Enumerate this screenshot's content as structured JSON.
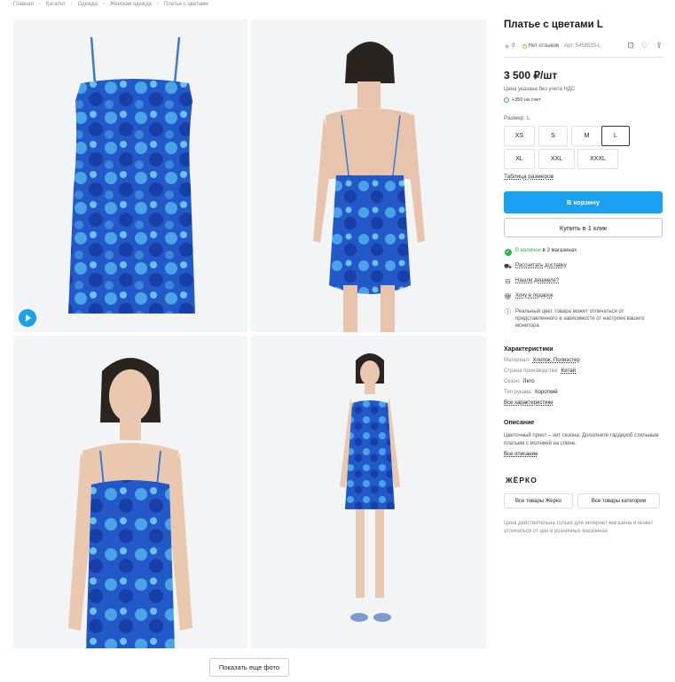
{
  "breadcrumb": [
    "Главная",
    "Каталог",
    "Одежда",
    "Женская одежда",
    "Платье с цветами"
  ],
  "gallery": {
    "photos": [
      {
        "alt": "dress-front-photo"
      },
      {
        "alt": "model-back-photo"
      },
      {
        "alt": "model-front-closeup-photo"
      },
      {
        "alt": "model-full-length-photo"
      }
    ],
    "more_label": "Показать еще фото"
  },
  "product": {
    "title": "Платье с цветами L",
    "rating": "0",
    "reviews": "Нет отзывов",
    "article": "Арт. 5456535-L",
    "price": "3 500 ₽/шт",
    "vat_note": "Цена указана без учета НДС",
    "bonus": "+350 на счет"
  },
  "sizes": {
    "label": "Размер: L",
    "options": [
      "XS",
      "S",
      "M",
      "L",
      "XL",
      "XXL",
      "XXXL"
    ],
    "selected": "L",
    "table_link": "Таблица размеров"
  },
  "actions": {
    "cart": "В корзину",
    "one_click": "Купить в 1 клик"
  },
  "features": {
    "availability_prefix": "В наличии",
    "availability_suffix": " в 3 магазинах",
    "delivery": "Рассчитать доставку",
    "cheaper": "Нашли дешевле?",
    "gift": "Хочу в подарок",
    "color_note": "Реальный цвет товара может отличаться от представленного в зависимости от настроек вашего монитора"
  },
  "specs": {
    "title": "Характеристики",
    "rows": [
      {
        "label": "Материал:",
        "value": "Хлопок, Полиэстер"
      },
      {
        "label": "Страна производства:",
        "value": "Китай"
      },
      {
        "label": "Сезон:",
        "value": "Лето"
      },
      {
        "label": "Тип рукава:",
        "value": "Короткий"
      }
    ],
    "all_link": "Все характеристики"
  },
  "description": {
    "title": "Описание",
    "text": "Цветочный принт – хит сезона. Дополните гардероб стильным платьем с молнией на спине.",
    "all_link": "Все описание"
  },
  "brand": {
    "logo": "ЖЁРКО",
    "all_brand": "Все товары Жерко",
    "all_category": "Все товары категории"
  },
  "price_note": "Цена действительна только для интернет-магазина и может отличаться от цен в розничных магазинах",
  "colors": {
    "accent": "#1ba1f2",
    "dress_dark": "#1f4fc0",
    "dress_light": "#4fa8e8",
    "in_stock": "#2fb54a"
  }
}
